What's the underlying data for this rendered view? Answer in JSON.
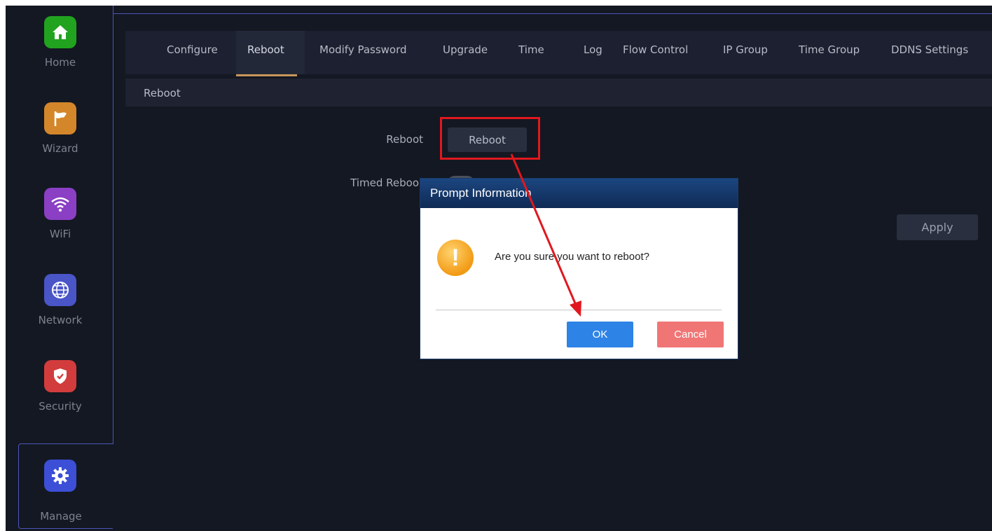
{
  "sidebar": {
    "items": [
      {
        "label": "Home",
        "icon": "home-icon",
        "color": "#21a31f"
      },
      {
        "label": "Wizard",
        "icon": "flag-icon",
        "color": "#d4862a"
      },
      {
        "label": "WiFi",
        "icon": "wifi-icon",
        "color": "#8b3fc4"
      },
      {
        "label": "Network",
        "icon": "globe-icon",
        "color": "#4a55c8"
      },
      {
        "label": "Security",
        "icon": "shield-icon",
        "color": "#d23c3c"
      },
      {
        "label": "Manage",
        "icon": "gear-icon",
        "color": "#3c4fd6",
        "active": true
      }
    ]
  },
  "tabs": [
    "Configure",
    "Reboot",
    "Modify Password",
    "Upgrade",
    "Time",
    "Log",
    "Flow Control",
    "IP Group",
    "Time Group",
    "DDNS Settings"
  ],
  "active_tab": "Reboot",
  "section": {
    "title": "Reboot"
  },
  "form": {
    "reboot_label": "Reboot",
    "reboot_button": "Reboot",
    "timed_reboot_label": "Timed Reboo",
    "apply_button": "Apply"
  },
  "dialog": {
    "title": "Prompt Information",
    "message": "Are you sure you want to reboot?",
    "ok": "OK",
    "cancel": "Cancel"
  },
  "annotation": {
    "highlight_color": "#e0181e"
  }
}
